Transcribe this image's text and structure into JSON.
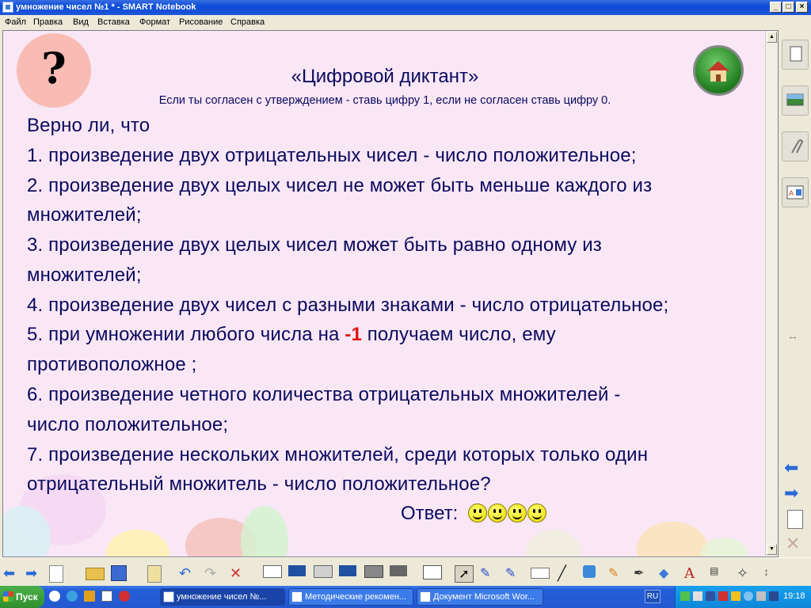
{
  "window": {
    "title": "умножение чисел №1 * - SMART Notebook",
    "controls": [
      "_",
      "□",
      "×"
    ]
  },
  "menu": [
    "Файл",
    "Правка",
    "Вид",
    "Вставка",
    "Формат",
    "Рисование",
    "Справка"
  ],
  "slide": {
    "question_mark": "?",
    "title": "«Цифровой диктант»",
    "subtitle": "Если ты  согласен с утверждением - ставь цифру 1, если не согласен ставь цифру 0.",
    "intro": "Верно ли, что",
    "lines": [
      "1. произведение двух отрицательных чисел - число положительное;",
      "2. произведение двух целых чисел не может быть меньше каждого из",
      "множителей;",
      "3. произведение двух целых чисел может быть равно одному из",
      "множителей;",
      "4. произведение двух чисел с разными знаками - число отрицательное;",
      "5. при умножении любого числа на ",
      "-1",
      " получаем число, ему",
      "противоположное ;",
      "6. произведение четного количества отрицательных множителей -",
      "число положительное;",
      "7. произведение нескольких множителей, среди которых только один",
      "отрицательный множитель - число положительное?"
    ],
    "answer_label": "Ответ:"
  },
  "taskbar": {
    "start": "Пуск",
    "items": [
      "умножение чисел №...",
      "Методические рекомен...",
      "Документ Microsoft Wor..."
    ],
    "lang": "RU",
    "clock": "19:18"
  }
}
